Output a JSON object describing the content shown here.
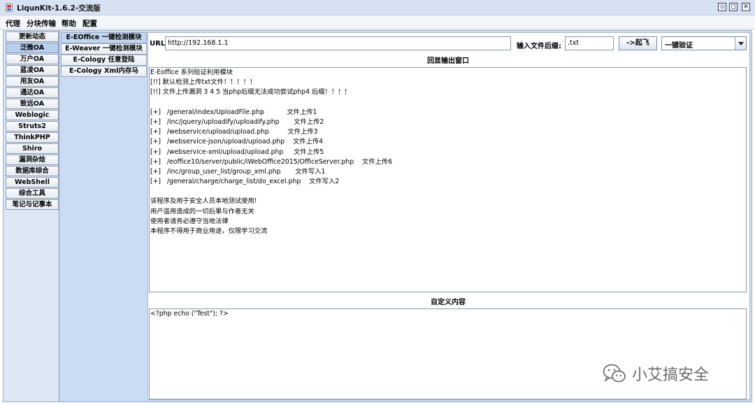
{
  "window": {
    "title": "LiqunKit-1.6.2-交流版",
    "buttons": [
      "restore",
      "maximize",
      "close"
    ]
  },
  "menu": [
    "代理",
    "分块传输",
    "帮助",
    "配置"
  ],
  "categories": {
    "items": [
      "更新动态",
      "泛微OA",
      "万户OA",
      "蓝凌OA",
      "用友OA",
      "通达OA",
      "致远OA",
      "Weblogic",
      "Struts2",
      "ThinkPHP",
      "Shiro",
      "漏洞杂烩",
      "数据库综合",
      "WebShell",
      "综合工具",
      "笔记与记事本"
    ],
    "selected": "泛微OA"
  },
  "modules": {
    "items": [
      "E-EOffice 一键检测模块",
      "E-Weaver 一键检测模块",
      "E-Cology 任意登陆",
      "E-Cology Xml内存马"
    ],
    "selected": "E-EOffice 一键检测模块"
  },
  "form": {
    "url_label": "URL:",
    "url_value": "http://192.168.1.1",
    "suffix_label": "输入文件后缀:",
    "suffix_value": ".txt",
    "go_button": "->起飞",
    "mode_selected": "一键验证"
  },
  "output": {
    "title": "回显输出窗口",
    "lines": [
      "E-Eoffice 系列验证利用模块",
      "[!!] 默认检测上传txt文件！！！！！",
      "[!!] 文件上传漏洞 3 4 5 当php后缀无法成功尝试php4 后缀！！！！",
      "",
      "[+]   /general/index/UploadFile.php           文件上传1",
      "[+]   /inc/jquery/uploadify/uploadify.php       文件上传2",
      "[+]   /webservice/upload/upload.php         文件上传3",
      "[+]   /webservice-json/upload/upload.php    文件上传4",
      "[+]   /webservice-xml/upload/upload.php     文件上传5",
      "[+]   /eoffice10/server/public/iWebOffice2015/OfficeServer.php    文件上传6",
      "[+]   /inc/group_user_list/group_xml.php       文件写入1",
      "[+]   /general/charge/charge_list/do_excel.php    文件写入2",
      "",
      "该程序及用于安全人员本地测试使用!",
      "用户滥用造成的一切后果与作者无关",
      "使用者请务必遵守当地法律",
      "本程序不得用于商业用途，仅限学习交流"
    ]
  },
  "custom": {
    "title": "自定义内容",
    "content": "<?php echo (\"Test\"); ?>"
  },
  "watermark": {
    "text": "小艾搞安全",
    "icon": "wechat-icon"
  },
  "colors": {
    "titlebar": "#d6e1f2",
    "panel": "#c9dcf3",
    "selected_tab": "#b9cfee"
  }
}
